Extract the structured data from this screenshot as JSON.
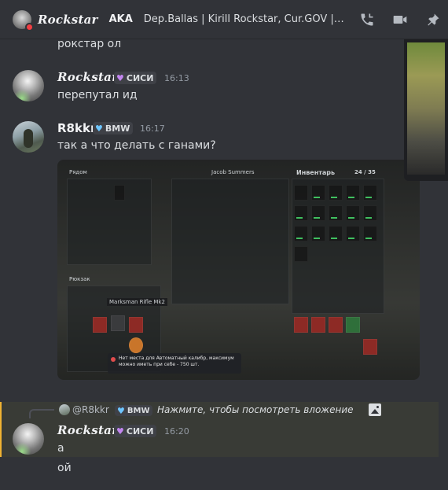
{
  "header": {
    "name": "Rockstar",
    "tag": "AKA",
    "status": "Dep.Ballas | Kirill Rockstar, Cur.GOV | Ro..."
  },
  "messages": {
    "prev_text": "рокстар ол",
    "m1": {
      "user": "Rockstar",
      "badge": "СИСИ",
      "time": "16:13",
      "text": "перепутал ид"
    },
    "m2": {
      "user": "R8kkr",
      "badge": "BMW",
      "time": "16:17",
      "text": "так а что делать с ганами?"
    },
    "attachment": {
      "nearby": "Рядом",
      "player": "Jacob Summers",
      "inventory": "Инвентарь",
      "capacity": "24 / 35",
      "backpack": "Рюкзак",
      "item_name": "Marksman Rifle Mk2",
      "tooltip": "Нет места для Автоматный калибр, максимум можно иметь при себе - 750 шт."
    },
    "reply": {
      "user": "@R8kkr",
      "badge": "BMW",
      "text": "Нажмите, чтобы посмотреть вложение"
    },
    "m3": {
      "user": "Rockstar",
      "badge": "СИСИ",
      "time": "16:20",
      "text1": "а",
      "text2": "ой"
    }
  },
  "colors": {
    "background": "#313338",
    "highlight_bar": "#f0b232",
    "badge_heart_purple": "#c386f0",
    "badge_heart_blue": "#6ec6ff"
  }
}
